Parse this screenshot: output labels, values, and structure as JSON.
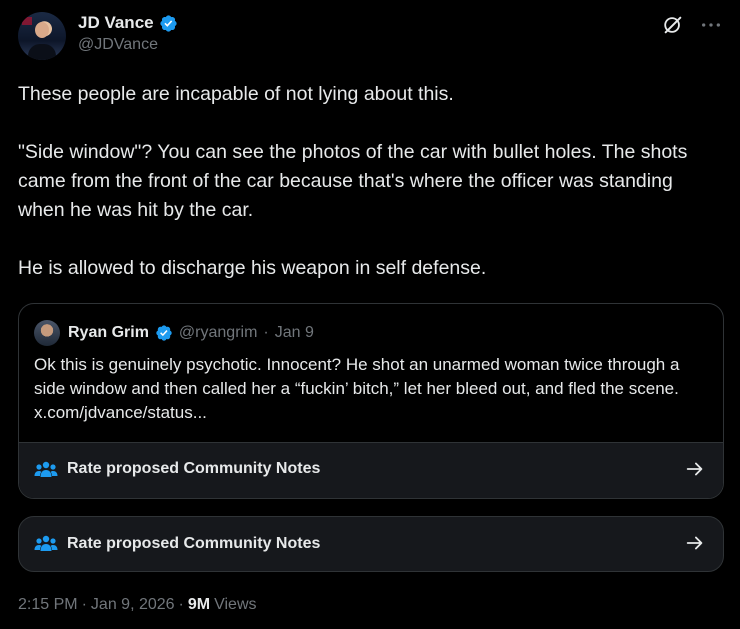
{
  "author": {
    "display_name": "JD Vance",
    "handle": "@JDVance"
  },
  "tweet": {
    "text": "These people are incapable of not lying about this.\n\n\"Side window\"? You can see the photos of the car with bullet holes. The shots came from the front of the car because that's where the officer was standing when he was hit by the car.\n\nHe is allowed to discharge his weapon in self defense."
  },
  "quote": {
    "display_name": "Ryan Grim",
    "handle": "@ryangrim",
    "separator": "·",
    "date": "Jan 9",
    "text": "Ok this is genuinely psychotic. Innocent? He shot an unarmed woman twice through a side window and then called her a “fuckin’ bitch,” let her bleed out, and fled the scene. x.com/jdvance/status...",
    "community_notes_label": "Rate proposed Community Notes"
  },
  "community_notes_card": {
    "label": "Rate proposed Community Notes"
  },
  "meta": {
    "time": "2:15 PM",
    "sep1": "·",
    "date": "Jan 9, 2026",
    "sep2": "·",
    "views_count": "9M",
    "views_label": "Views"
  },
  "colors": {
    "background": "#000000",
    "text": "#e7e9ea",
    "muted": "#71767b",
    "border": "#2f3336",
    "card": "#16181c",
    "verified": "#1d9bf0"
  },
  "icons": {
    "verified": "verified-badge-icon",
    "grok": "grok-icon",
    "more": "more-icon",
    "community_notes": "community-notes-people-icon",
    "arrow": "arrow-right-icon"
  }
}
